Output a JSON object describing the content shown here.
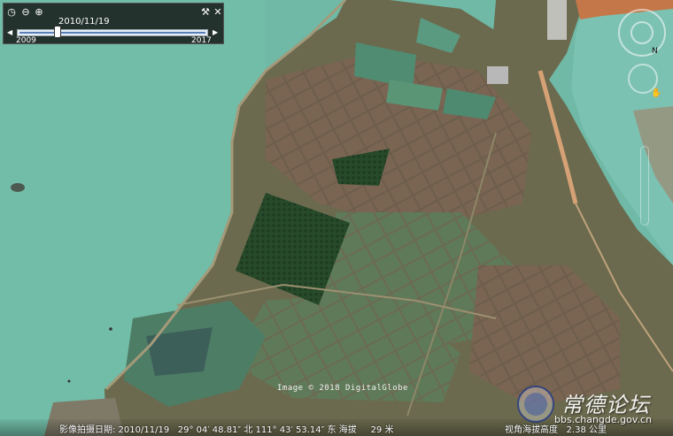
{
  "time_slider": {
    "current_date": "2010/11/19",
    "start_year": "2009",
    "end_year": "2017",
    "position_fraction": 0.2
  },
  "credit": "Image © 2018 DigitalGlobe",
  "status_bar": {
    "text": "影像拍摄日期: 2010/11/19   29° 04′ 48.81″ 北 111° 43′ 53.14″ 东 海拔     29 米",
    "elevation_text": "视角海拔高度   2.38 公里"
  },
  "watermark": {
    "title": "常德论坛",
    "url": "bbs.changde.gov.cn"
  },
  "nav": {
    "north": "N"
  },
  "colors": {
    "water": "#6fb9a6",
    "land": "#6b6a4e",
    "field_green": "#2f4f2c",
    "field_purple": "#6a4a4a",
    "river": "#7cc2b2"
  }
}
